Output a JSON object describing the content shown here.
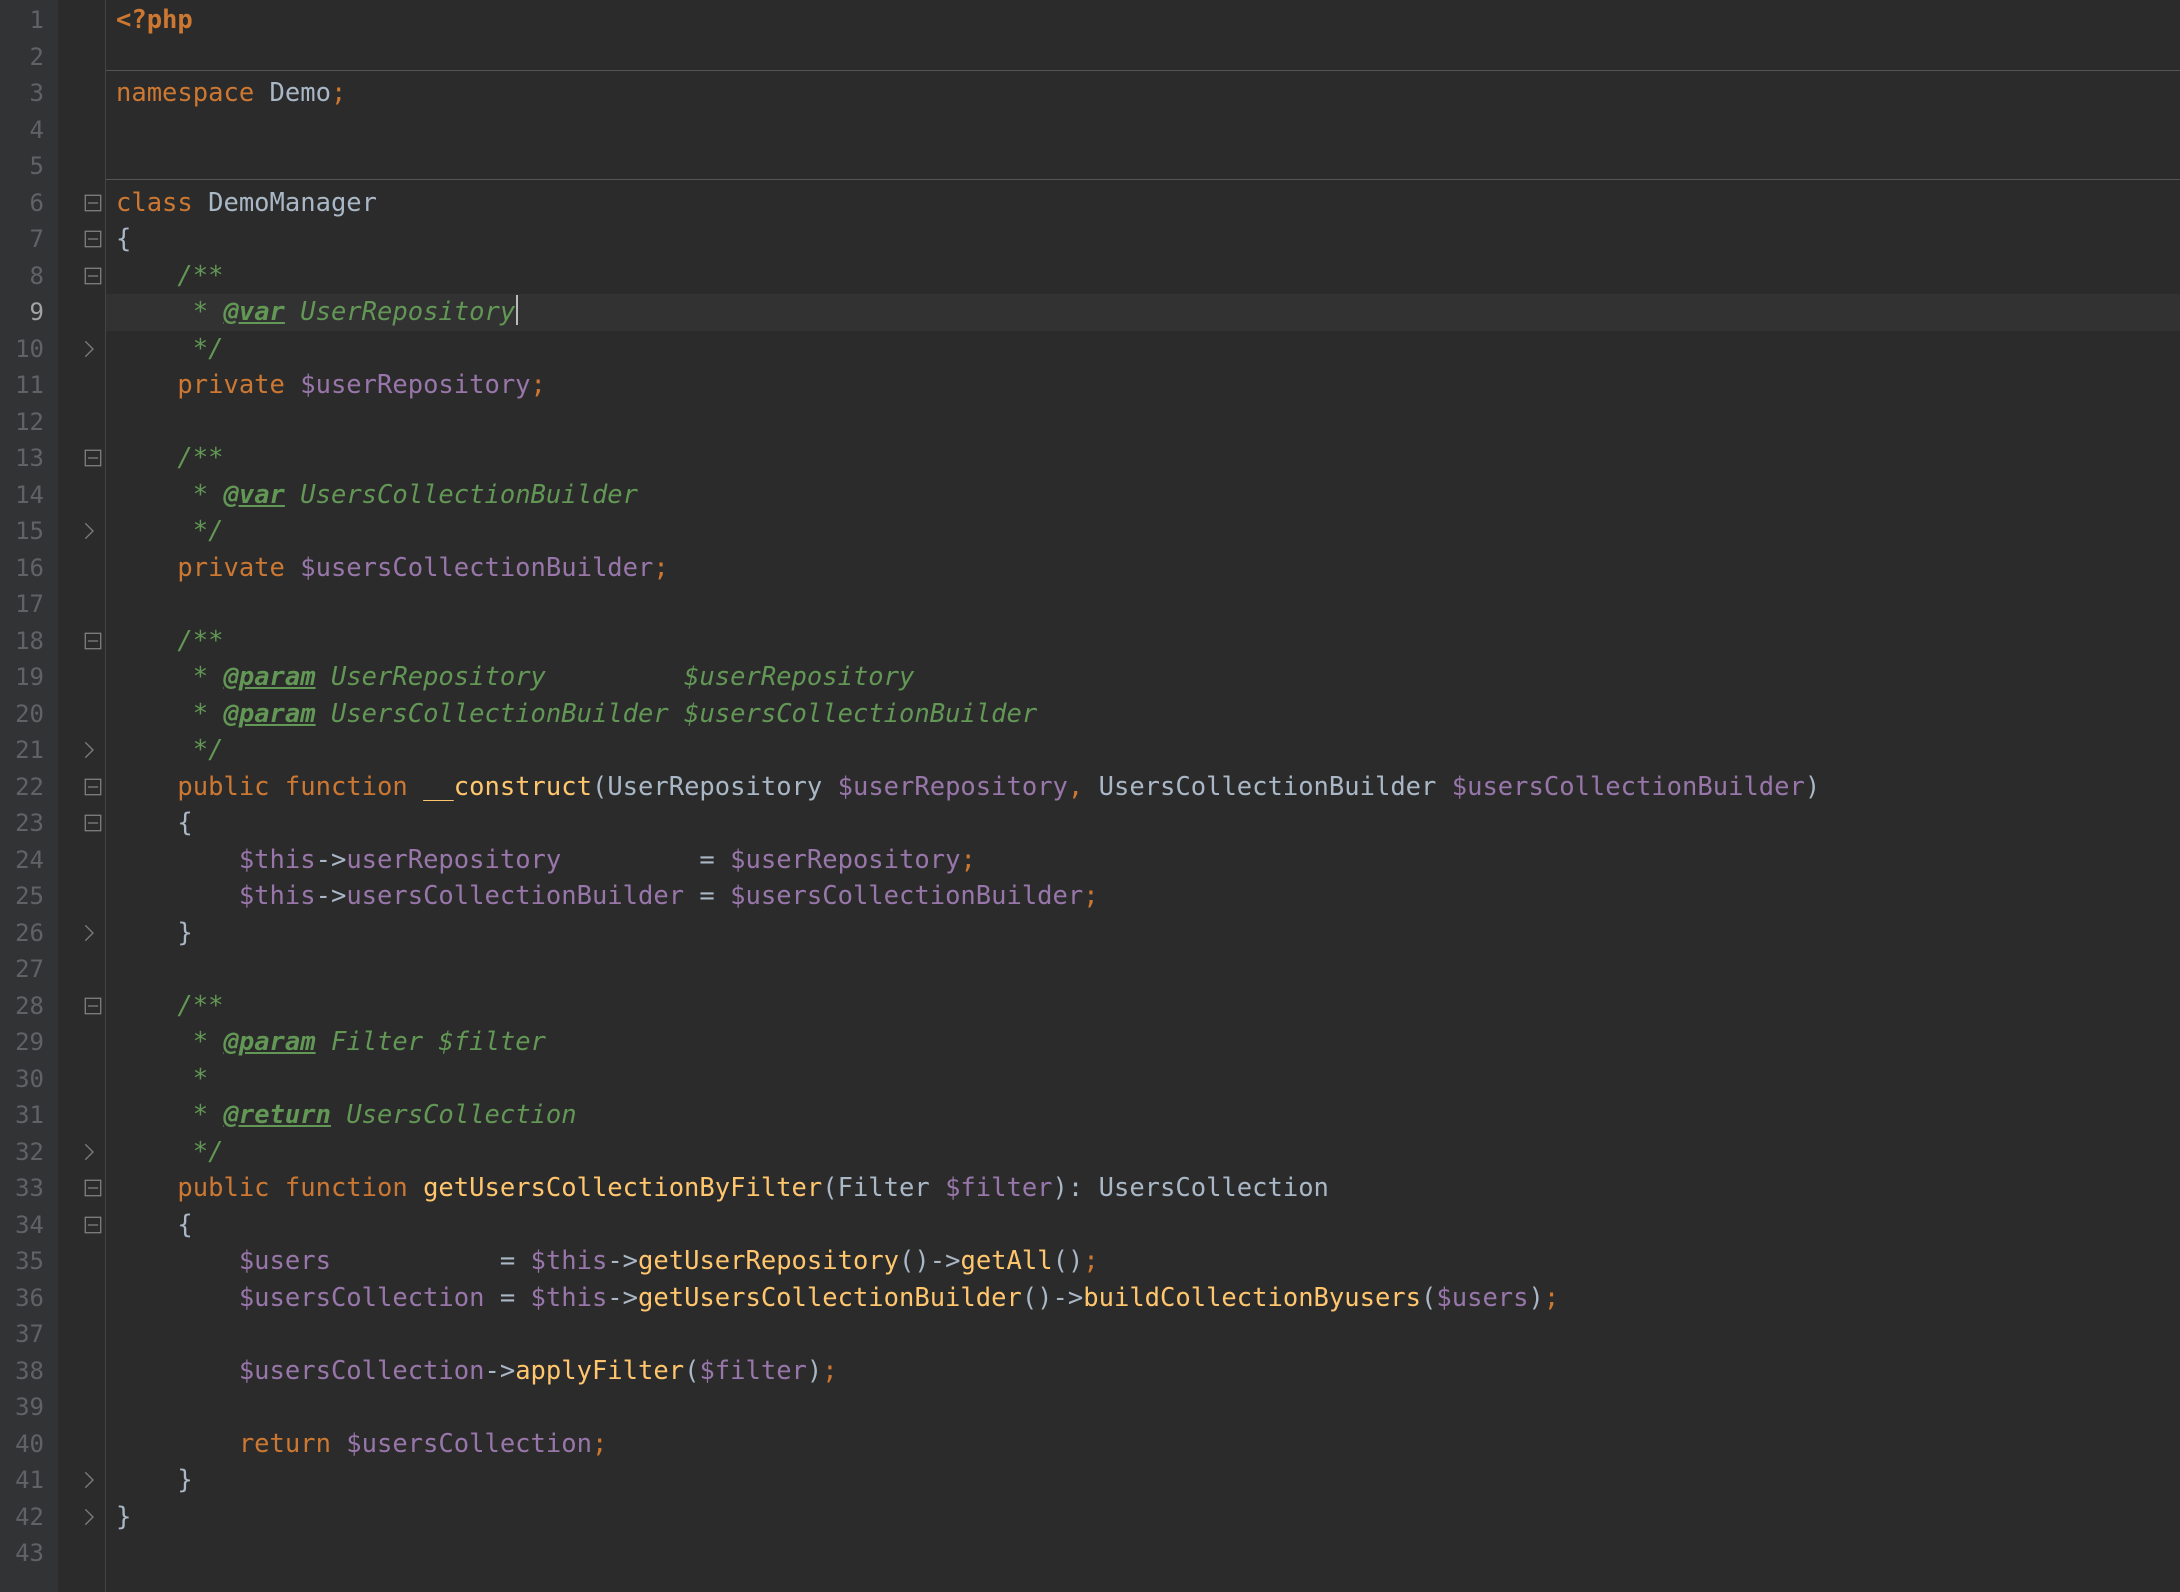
{
  "current_line": 9,
  "gutter": [
    "1",
    "2",
    "3",
    "4",
    "5",
    "6",
    "7",
    "8",
    "9",
    "10",
    "11",
    "12",
    "13",
    "14",
    "15",
    "16",
    "17",
    "18",
    "19",
    "20",
    "21",
    "22",
    "23",
    "24",
    "25",
    "26",
    "27",
    "28",
    "29",
    "30",
    "31",
    "32",
    "33",
    "34",
    "35",
    "36",
    "37",
    "38",
    "39",
    "40",
    "41",
    "42",
    "43"
  ],
  "fold": {
    "open_rows": [
      6,
      7,
      8,
      13,
      18,
      22,
      23,
      28,
      33,
      34
    ],
    "close_rows": [
      10,
      15,
      21,
      26,
      32,
      41,
      42
    ]
  },
  "lines": {
    "l1": {
      "indent": "",
      "tokens": [
        {
          "c": "phpopen",
          "t": "<?php"
        }
      ]
    },
    "l2": {
      "indent": "",
      "tokens": []
    },
    "l3": {
      "indent": "",
      "tokens": [
        {
          "c": "kw",
          "t": "namespace "
        },
        {
          "c": "cls",
          "t": "Demo"
        },
        {
          "c": "punct",
          "t": ";"
        }
      ]
    },
    "l4": {
      "indent": "",
      "tokens": []
    },
    "l5": {
      "indent": "",
      "tokens": []
    },
    "l6": {
      "indent": "",
      "tokens": [
        {
          "c": "kw",
          "t": "class "
        },
        {
          "c": "cls",
          "t": "DemoManager"
        }
      ]
    },
    "l7": {
      "indent": "",
      "tokens": [
        {
          "c": "brace",
          "t": "{"
        }
      ]
    },
    "l8": {
      "indent": "    ",
      "tokens": [
        {
          "c": "doc",
          "t": "/**"
        }
      ]
    },
    "l9": {
      "indent": "     ",
      "tokens": [
        {
          "c": "doc",
          "t": "* "
        },
        {
          "c": "doc-tag",
          "t": "@var"
        },
        {
          "c": "doc",
          "t": " "
        },
        {
          "c": "doc-cls",
          "t": "UserRepository"
        }
      ],
      "caret": true
    },
    "l10": {
      "indent": "     ",
      "tokens": [
        {
          "c": "doc",
          "t": "*/"
        }
      ]
    },
    "l11": {
      "indent": "    ",
      "tokens": [
        {
          "c": "kw",
          "t": "private "
        },
        {
          "c": "var",
          "t": "$userRepository"
        },
        {
          "c": "punct",
          "t": ";"
        }
      ]
    },
    "l12": {
      "indent": "",
      "tokens": []
    },
    "l13": {
      "indent": "    ",
      "tokens": [
        {
          "c": "doc",
          "t": "/**"
        }
      ]
    },
    "l14": {
      "indent": "     ",
      "tokens": [
        {
          "c": "doc",
          "t": "* "
        },
        {
          "c": "doc-tag",
          "t": "@var"
        },
        {
          "c": "doc",
          "t": " "
        },
        {
          "c": "doc-cls",
          "t": "UsersCollectionBuilder"
        }
      ]
    },
    "l15": {
      "indent": "     ",
      "tokens": [
        {
          "c": "doc",
          "t": "*/"
        }
      ]
    },
    "l16": {
      "indent": "    ",
      "tokens": [
        {
          "c": "kw",
          "t": "private "
        },
        {
          "c": "var",
          "t": "$usersCollectionBuilder"
        },
        {
          "c": "punct",
          "t": ";"
        }
      ]
    },
    "l17": {
      "indent": "",
      "tokens": []
    },
    "l18": {
      "indent": "    ",
      "tokens": [
        {
          "c": "doc",
          "t": "/**"
        }
      ]
    },
    "l19": {
      "indent": "     ",
      "tokens": [
        {
          "c": "doc",
          "t": "* "
        },
        {
          "c": "doc-tag",
          "t": "@param"
        },
        {
          "c": "doc",
          "t": " "
        },
        {
          "c": "doc-cls",
          "t": "UserRepository"
        },
        {
          "c": "doc",
          "t": "         "
        },
        {
          "c": "doc-cls",
          "t": "$userRepository"
        }
      ]
    },
    "l20": {
      "indent": "     ",
      "tokens": [
        {
          "c": "doc",
          "t": "* "
        },
        {
          "c": "doc-tag",
          "t": "@param"
        },
        {
          "c": "doc",
          "t": " "
        },
        {
          "c": "doc-cls",
          "t": "UsersCollectionBuilder"
        },
        {
          "c": "doc",
          "t": " "
        },
        {
          "c": "doc-cls",
          "t": "$usersCollectionBuilder"
        }
      ]
    },
    "l21": {
      "indent": "     ",
      "tokens": [
        {
          "c": "doc",
          "t": "*/"
        }
      ]
    },
    "l22": {
      "indent": "    ",
      "tokens": [
        {
          "c": "kw",
          "t": "public "
        },
        {
          "c": "kw",
          "t": "function "
        },
        {
          "c": "fn",
          "t": "__construct"
        },
        {
          "c": "brace",
          "t": "("
        },
        {
          "c": "cls",
          "t": "UserRepository "
        },
        {
          "c": "var",
          "t": "$userRepository"
        },
        {
          "c": "punct",
          "t": ", "
        },
        {
          "c": "cls",
          "t": "UsersCollectionBuilder "
        },
        {
          "c": "var",
          "t": "$usersCollectionBuilder"
        },
        {
          "c": "brace",
          "t": ")"
        }
      ]
    },
    "l23": {
      "indent": "    ",
      "tokens": [
        {
          "c": "brace",
          "t": "{"
        }
      ]
    },
    "l24": {
      "indent": "        ",
      "tokens": [
        {
          "c": "var",
          "t": "$this"
        },
        {
          "c": "arrow",
          "t": "->"
        },
        {
          "c": "var",
          "t": "userRepository"
        },
        {
          "c": "op",
          "t": "         = "
        },
        {
          "c": "var",
          "t": "$userRepository"
        },
        {
          "c": "punct",
          "t": ";"
        }
      ]
    },
    "l25": {
      "indent": "        ",
      "tokens": [
        {
          "c": "var",
          "t": "$this"
        },
        {
          "c": "arrow",
          "t": "->"
        },
        {
          "c": "var",
          "t": "usersCollectionBuilder"
        },
        {
          "c": "op",
          "t": " = "
        },
        {
          "c": "var",
          "t": "$usersCollectionBuilder"
        },
        {
          "c": "punct",
          "t": ";"
        }
      ]
    },
    "l26": {
      "indent": "    ",
      "tokens": [
        {
          "c": "brace",
          "t": "}"
        }
      ]
    },
    "l27": {
      "indent": "",
      "tokens": []
    },
    "l28": {
      "indent": "    ",
      "tokens": [
        {
          "c": "doc",
          "t": "/**"
        }
      ]
    },
    "l29": {
      "indent": "     ",
      "tokens": [
        {
          "c": "doc",
          "t": "* "
        },
        {
          "c": "doc-tag",
          "t": "@param"
        },
        {
          "c": "doc",
          "t": " "
        },
        {
          "c": "doc-cls",
          "t": "Filter"
        },
        {
          "c": "doc",
          "t": " "
        },
        {
          "c": "doc-cls",
          "t": "$filter"
        }
      ]
    },
    "l30": {
      "indent": "     ",
      "tokens": [
        {
          "c": "doc",
          "t": "*"
        }
      ]
    },
    "l31": {
      "indent": "     ",
      "tokens": [
        {
          "c": "doc",
          "t": "* "
        },
        {
          "c": "doc-tag",
          "t": "@return"
        },
        {
          "c": "doc",
          "t": " "
        },
        {
          "c": "doc-cls",
          "t": "UsersCollection"
        }
      ]
    },
    "l32": {
      "indent": "     ",
      "tokens": [
        {
          "c": "doc",
          "t": "*/"
        }
      ]
    },
    "l33": {
      "indent": "    ",
      "tokens": [
        {
          "c": "kw",
          "t": "public "
        },
        {
          "c": "kw",
          "t": "function "
        },
        {
          "c": "fn",
          "t": "getUsersCollectionByFilter"
        },
        {
          "c": "brace",
          "t": "("
        },
        {
          "c": "cls",
          "t": "Filter "
        },
        {
          "c": "var",
          "t": "$filter"
        },
        {
          "c": "brace",
          "t": ")"
        },
        {
          "c": "op",
          "t": ": "
        },
        {
          "c": "cls",
          "t": "UsersCollection"
        }
      ]
    },
    "l34": {
      "indent": "    ",
      "tokens": [
        {
          "c": "brace",
          "t": "{"
        }
      ]
    },
    "l35": {
      "indent": "        ",
      "tokens": [
        {
          "c": "var",
          "t": "$users"
        },
        {
          "c": "op",
          "t": "           = "
        },
        {
          "c": "var",
          "t": "$this"
        },
        {
          "c": "arrow",
          "t": "->"
        },
        {
          "c": "fn",
          "t": "getUserRepository"
        },
        {
          "c": "brace",
          "t": "()"
        },
        {
          "c": "arrow",
          "t": "->"
        },
        {
          "c": "fn",
          "t": "getAll"
        },
        {
          "c": "brace",
          "t": "()"
        },
        {
          "c": "punct",
          "t": ";"
        }
      ]
    },
    "l36": {
      "indent": "        ",
      "tokens": [
        {
          "c": "var",
          "t": "$usersCollection"
        },
        {
          "c": "op",
          "t": " = "
        },
        {
          "c": "var",
          "t": "$this"
        },
        {
          "c": "arrow",
          "t": "->"
        },
        {
          "c": "fn",
          "t": "getUsersCollectionBuilder"
        },
        {
          "c": "brace",
          "t": "()"
        },
        {
          "c": "arrow",
          "t": "->"
        },
        {
          "c": "fn",
          "t": "buildCollectionByusers"
        },
        {
          "c": "brace",
          "t": "("
        },
        {
          "c": "var",
          "t": "$users"
        },
        {
          "c": "brace",
          "t": ")"
        },
        {
          "c": "punct",
          "t": ";"
        }
      ]
    },
    "l37": {
      "indent": "",
      "tokens": []
    },
    "l38": {
      "indent": "        ",
      "tokens": [
        {
          "c": "var",
          "t": "$usersCollection"
        },
        {
          "c": "arrow",
          "t": "->"
        },
        {
          "c": "fn",
          "t": "applyFilter"
        },
        {
          "c": "brace",
          "t": "("
        },
        {
          "c": "var",
          "t": "$filter"
        },
        {
          "c": "brace",
          "t": ")"
        },
        {
          "c": "punct",
          "t": ";"
        }
      ]
    },
    "l39": {
      "indent": "",
      "tokens": []
    },
    "l40": {
      "indent": "        ",
      "tokens": [
        {
          "c": "kw",
          "t": "return "
        },
        {
          "c": "var",
          "t": "$usersCollection"
        },
        {
          "c": "punct",
          "t": ";"
        }
      ]
    },
    "l41": {
      "indent": "    ",
      "tokens": [
        {
          "c": "brace",
          "t": "}"
        }
      ]
    },
    "l42": {
      "indent": "",
      "tokens": [
        {
          "c": "brace",
          "t": "}"
        }
      ]
    },
    "l43": {
      "indent": "",
      "tokens": []
    }
  }
}
